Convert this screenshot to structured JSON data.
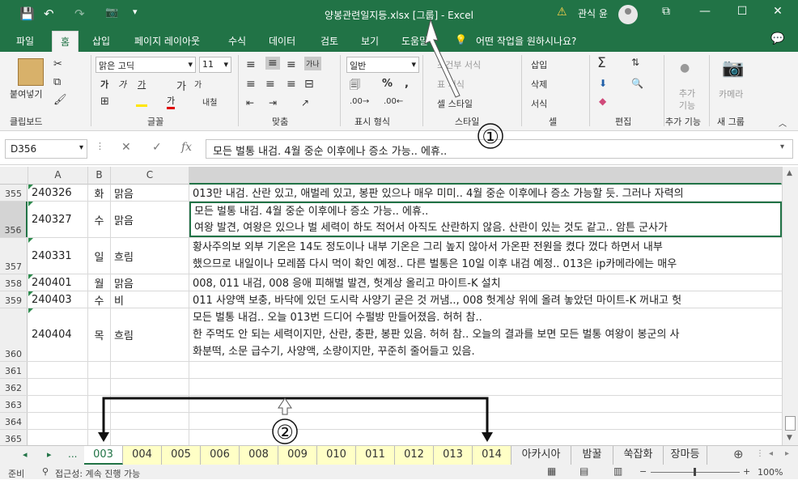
{
  "title_bar": {
    "title": "양봉관련일지등.xlsx  [그룹]  -  Excel",
    "warning": "⚠",
    "user": "관식 윤",
    "save_icon": "💾",
    "undo_icon": "↶",
    "redo_icon": "↷",
    "camera_icon": "📷",
    "more_icon": "▾",
    "restore_icon": "⧉",
    "min_icon": "—",
    "max_icon": "☐",
    "close_icon": "✕"
  },
  "tabs": [
    "파일",
    "홈",
    "삽입",
    "페이지 레이아웃",
    "수식",
    "데이터",
    "검토",
    "보기",
    "도움말"
  ],
  "tell_me": "어떤 작업을 원하시나요?",
  "ribbon": {
    "paste": "붙여넣기",
    "clipboard": "클립보드",
    "font_name": "맑은 고딕",
    "font_size": "11",
    "font_group": "글꼴",
    "align_group": "맞춤",
    "number_format": "일반",
    "number_group": "표시 형식",
    "cond_format": "조건부 서식",
    "table_format": "표 서식",
    "cell_style": "셀 스타일",
    "styles_group": "스타일",
    "insert": "삽입",
    "delete": "삭제",
    "format": "서식",
    "cells_group": "셀",
    "edit_group": "편집",
    "addin": "추가 기능",
    "addin_group": "추가 기능",
    "camera": "카메라",
    "new_group": "새 그룹",
    "bold": "가",
    "italic": "가",
    "underline": "가",
    "wrap": "내철",
    "percent": "%",
    "comma": ","
  },
  "formula_bar": {
    "name_box": "D356",
    "formula": "모든 벌통 내검. 4월 중순 이후에나 증소 가능.. 에휴.."
  },
  "columns": [
    "A",
    "B",
    "C"
  ],
  "rows": [
    {
      "num": "355",
      "a": "240326",
      "b": "화",
      "c": "맑음",
      "d": [
        "013만 내검. 산란 있고, 애벌레 있고, 봉판 있으나 매우 미미.. 4월 중순 이후에나 증소 가능할 듯. 그러나 자력의"
      ]
    },
    {
      "num": "356",
      "a": "240327",
      "b": "수",
      "c": "맑음",
      "d": [
        "모든 벌통 내검. 4월 중순 이후에나 증소 가능.. 에휴..",
        "여왕 발견, 여왕은 있으나 벌 세력이 하도 적어서 아직도 산란하지 않음. 산란이 있는 것도 같고.. 암튼 군사가"
      ]
    },
    {
      "num": "357",
      "a": "240331",
      "b": "일",
      "c": "흐림",
      "d": [
        "황사주의보 외부 기온은 14도 정도이나 내부 기온은 그리 높지 않아서 가온판 전원을 켰다 껐다 하면서 내부",
        "했으므로 내일이나 모레쯤 다시 먹이 확인 예정.. 다른 벌통은 10일 이후 내검 예정.. 013은 ip카메라에는 매우"
      ]
    },
    {
      "num": "358",
      "a": "240401",
      "b": "월",
      "c": "맑음",
      "d": [
        "008, 011 내검, 008 응애 피해벌 발견, 헛계상 올리고 마이트-K 설치"
      ]
    },
    {
      "num": "359",
      "a": "240403",
      "b": "수",
      "c": "비",
      "d": [
        "011 사양액 보충, 바닥에 있던 도시락 사양기 굳은 것 꺼냄.., 008 헛계상 위에 올려 놓았던 마이트-K 꺼내고 헛"
      ]
    },
    {
      "num": "360",
      "a": "240404",
      "b": "목",
      "c": "흐림",
      "d": [
        "모든 벌통 내검.. 오늘 013번 드디어 수펄방 만들어졌음. 허허 참..",
        "한 주먹도 안 되는 세력이지만, 산란, 충판, 봉판 있음. 허허 참.. 오늘의 결과를 보면 모든 벌통 여왕이 봉군의 사",
        "화분떡, 소문 급수기, 사양액, 소량이지만, 꾸준히 줄어들고 있음."
      ]
    },
    {
      "num": "361",
      "a": "",
      "b": "",
      "c": "",
      "d": []
    },
    {
      "num": "362",
      "a": "",
      "b": "",
      "c": "",
      "d": []
    },
    {
      "num": "363",
      "a": "",
      "b": "",
      "c": "",
      "d": []
    },
    {
      "num": "364",
      "a": "",
      "b": "",
      "c": "",
      "d": []
    },
    {
      "num": "365",
      "a": "",
      "b": "",
      "c": "",
      "d": []
    }
  ],
  "sheets": [
    "003",
    "004",
    "005",
    "006",
    "008",
    "009",
    "010",
    "011",
    "012",
    "013",
    "014",
    "아카시아",
    "밤꿀",
    "쑥잡화",
    "장마등"
  ],
  "sheet_nav": {
    "prev": "◂",
    "next": "▸",
    "more": "...",
    "add": "⊕"
  },
  "status": {
    "ready": "준비",
    "accessibility": "접근성: 계속 진행 가능",
    "zoom": "100%"
  },
  "annotations": {
    "one": "①",
    "two": "②"
  }
}
